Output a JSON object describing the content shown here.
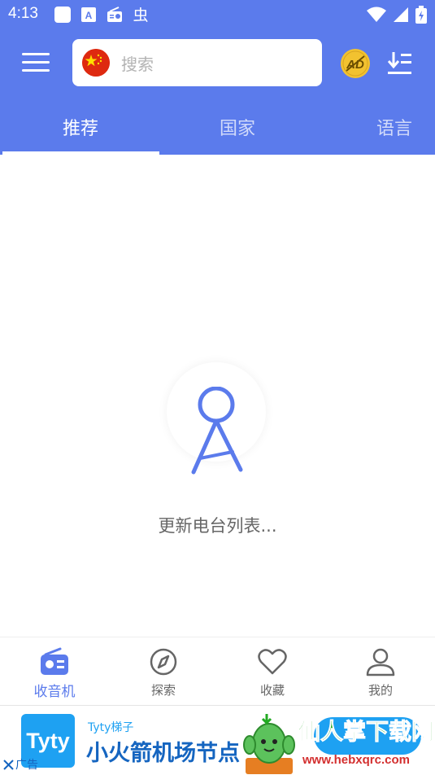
{
  "status_bar": {
    "time": "4:13",
    "left_icons": [
      "square-notification-icon",
      "a-font-icon",
      "radio-icon",
      "bug-icon"
    ],
    "right_icons": [
      "wifi-icon",
      "signal-icon",
      "battery-icon"
    ]
  },
  "toolbar": {
    "search_placeholder": "搜索",
    "country_flag": "china-flag-icon",
    "ad_icon_text": "AD"
  },
  "tabs": [
    {
      "label": "推荐",
      "active": true
    },
    {
      "label": "国家",
      "active": false
    },
    {
      "label": "语言",
      "active": false
    }
  ],
  "content": {
    "loading_text": "更新电台列表..."
  },
  "bottom_nav": [
    {
      "label": "收音机",
      "icon": "radio-icon",
      "active": true
    },
    {
      "label": "探索",
      "icon": "compass-icon",
      "active": false
    },
    {
      "label": "收藏",
      "icon": "heart-icon",
      "active": false
    },
    {
      "label": "我的",
      "icon": "person-icon",
      "active": false
    }
  ],
  "ad": {
    "logo_text": "Tyty",
    "brand": "Tyty梯子",
    "title": "小火箭机场节点",
    "close_label": "广告"
  },
  "watermark": {
    "text": "仙人掌下载网",
    "url": "www.hebxqrc.com"
  },
  "colors": {
    "primary": "#5b7bec",
    "ad_blue": "#1ea1f2",
    "ad_title": "#1565c0"
  }
}
